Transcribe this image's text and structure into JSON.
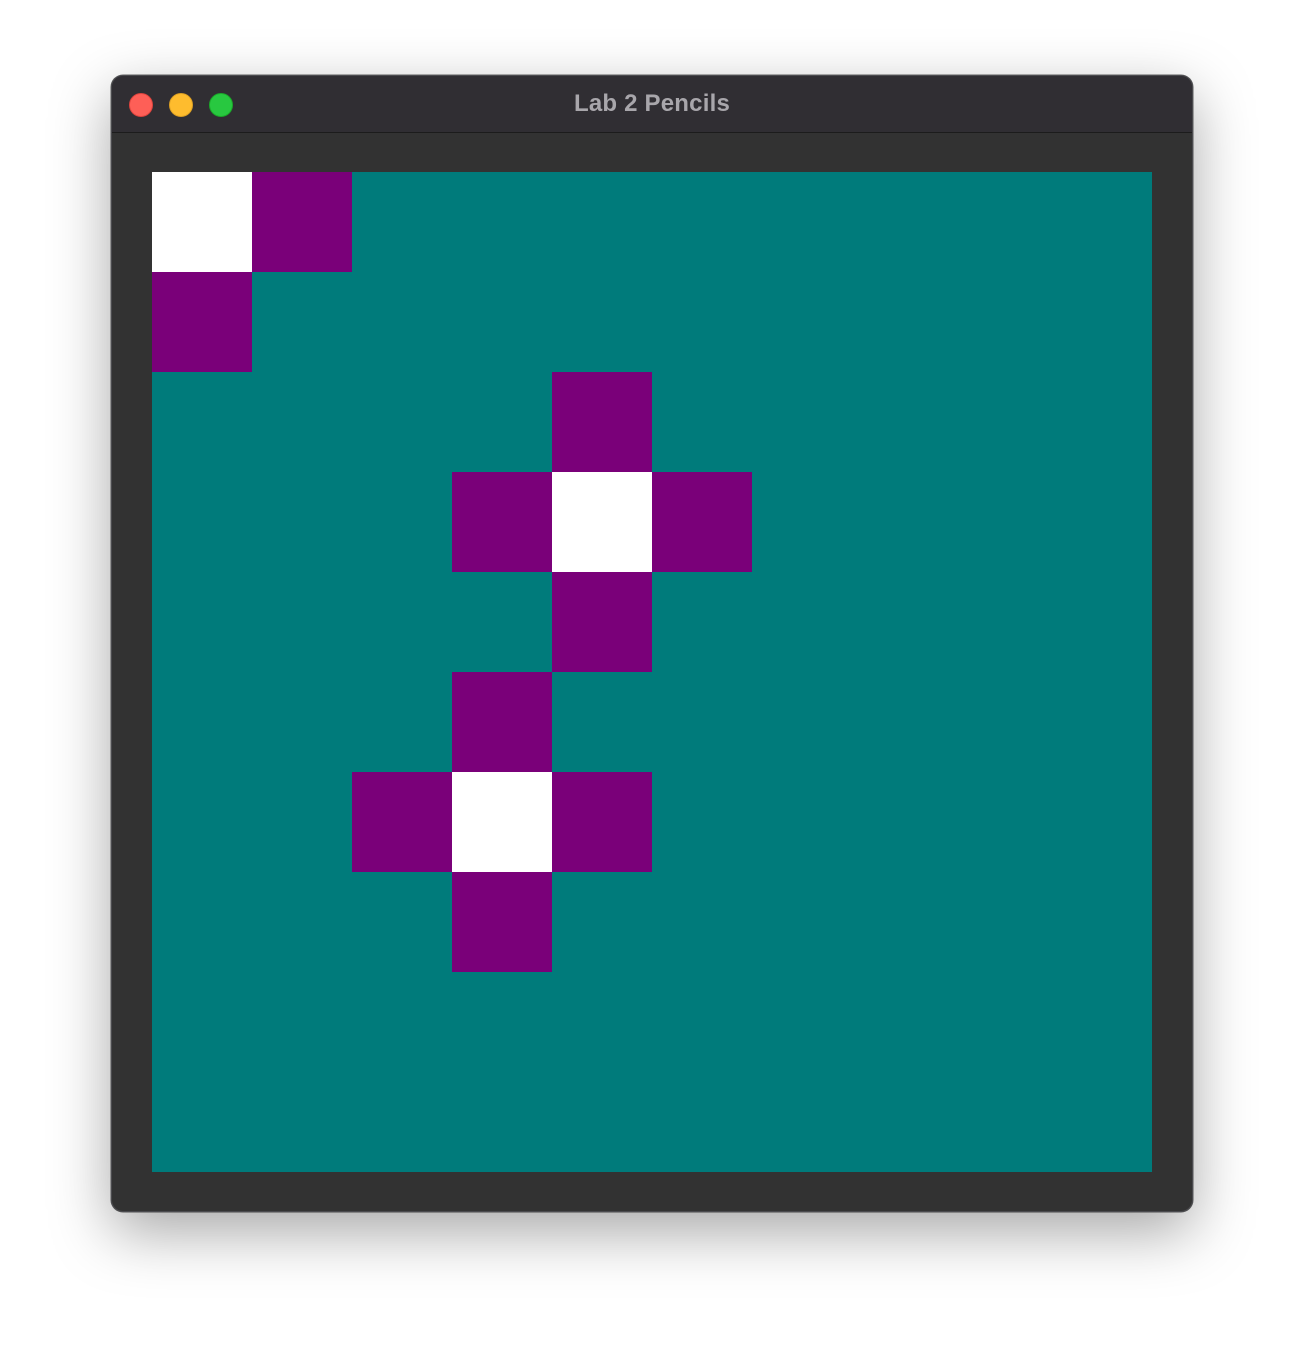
{
  "window": {
    "title": "Lab 2 Pencils"
  },
  "canvas": {
    "grid_columns": 10,
    "grid_rows": 10,
    "background_color": "#007b7b",
    "colors": {
      "pencil_center": "#ffffff",
      "pencil_neighbor": "#7a0079"
    },
    "cells": [
      {
        "col": 0,
        "row": 0,
        "kind": "pencil_center"
      },
      {
        "col": 1,
        "row": 0,
        "kind": "pencil_neighbor"
      },
      {
        "col": 0,
        "row": 1,
        "kind": "pencil_neighbor"
      },
      {
        "col": 4,
        "row": 2,
        "kind": "pencil_neighbor"
      },
      {
        "col": 3,
        "row": 3,
        "kind": "pencil_neighbor"
      },
      {
        "col": 4,
        "row": 3,
        "kind": "pencil_center"
      },
      {
        "col": 5,
        "row": 3,
        "kind": "pencil_neighbor"
      },
      {
        "col": 4,
        "row": 4,
        "kind": "pencil_neighbor"
      },
      {
        "col": 3,
        "row": 5,
        "kind": "pencil_neighbor"
      },
      {
        "col": 2,
        "row": 6,
        "kind": "pencil_neighbor"
      },
      {
        "col": 3,
        "row": 6,
        "kind": "pencil_center"
      },
      {
        "col": 4,
        "row": 6,
        "kind": "pencil_neighbor"
      },
      {
        "col": 3,
        "row": 7,
        "kind": "pencil_neighbor"
      }
    ]
  }
}
